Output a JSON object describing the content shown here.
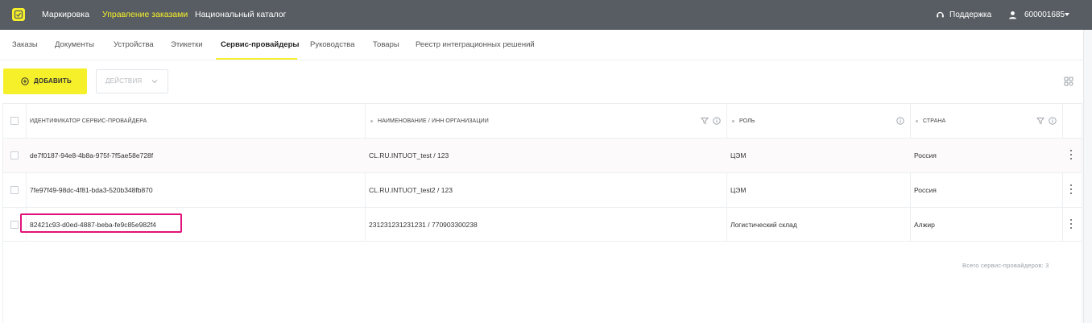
{
  "topbar": {
    "logo_icon": "app-logo-icon",
    "nav": [
      {
        "label": "Маркировка",
        "active": false
      },
      {
        "label": "Управление заказами",
        "active": true
      },
      {
        "label": "Национальный каталог",
        "active": false
      }
    ],
    "support_label": "Поддержка",
    "account_label": "600001685",
    "accent_color": "#f6f02a"
  },
  "subnav": {
    "tabs": [
      {
        "label": "Заказы",
        "active": false
      },
      {
        "label": "Документы",
        "active": false
      },
      {
        "label": "Устройства",
        "active": false
      },
      {
        "label": "Этикетки",
        "active": false
      },
      {
        "label": "Сервис-провайдеры",
        "active": true
      },
      {
        "label": "Руководства",
        "active": false
      },
      {
        "label": "Товары",
        "active": false
      },
      {
        "label": "Реестр интеграционных решений",
        "active": false
      }
    ]
  },
  "toolbar": {
    "add_label": "ДОБАВИТЬ",
    "actions_label": "ДЕЙСТВИЯ",
    "actions_enabled": false
  },
  "table": {
    "columns": [
      {
        "label": "ИДЕНТИФИКАТОР СЕРВИС-ПРОВАЙДЕРА"
      },
      {
        "label": "НАИМЕНОВАНИЕ / ИНН ОРГАНИЗАЦИИ"
      },
      {
        "label": "РОЛЬ"
      },
      {
        "label": "СТРАНА"
      }
    ],
    "rows": [
      {
        "id": "de7f0187-94e8-4b8a-975f-7f5ae58e728f",
        "name": "CL.RU.INTUOT_test / 123",
        "role": "ЦЭМ",
        "country": "Россия"
      },
      {
        "id": "7fe97f49-98dc-4f81-bda3-520b348fb870",
        "name": "CL.RU.INTUOT_test2 / 123",
        "role": "ЦЭМ",
        "country": "Россия"
      },
      {
        "id": "82421c93-d0ed-4887-beba-fe9c85e982f4",
        "name": "231231231231231 / 770903300238",
        "role": "Логистический склад",
        "country": "Алжир",
        "highlighted": true
      }
    ],
    "highlight_color": "#e0137a",
    "total_label": "Всего сервис-провайдеров: 3"
  }
}
